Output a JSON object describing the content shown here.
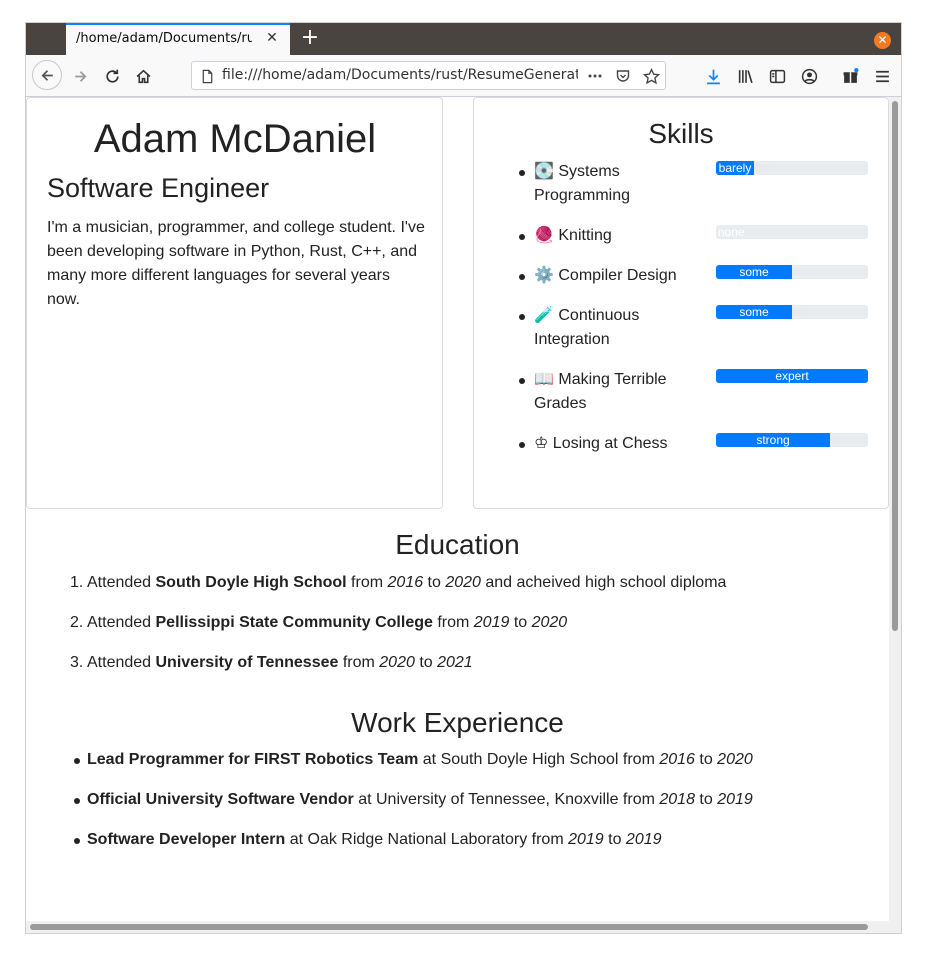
{
  "browser": {
    "tab_title": "/home/adam/Documents/rust",
    "tab_close": "✕",
    "new_tab": "+",
    "url": "file:///home/adam/Documents/rust/ResumeGenerator/",
    "window_close": "✕",
    "accent_color": "#0a84ff"
  },
  "profile": {
    "name": "Adam McDaniel",
    "role": "Software Engineer",
    "bio": "I'm a musician, programmer, and college student. I've been developing software in Python, Rust, C++, and many more different languages for several years now."
  },
  "skills": {
    "title": "Skills",
    "bar_color": "#007bff",
    "items": [
      {
        "icon": "💽",
        "label": "Systems Programming",
        "level": "barely",
        "fraction": 0.25
      },
      {
        "icon": "🧶",
        "label": "Knitting",
        "level": "none",
        "fraction": 0.0
      },
      {
        "icon": "⚙️",
        "label": "Compiler Design",
        "level": "some",
        "fraction": 0.5
      },
      {
        "icon": "🧪",
        "label": "Continuous Integration",
        "level": "some",
        "fraction": 0.5
      },
      {
        "icon": "📖",
        "label": "Making Terrible Grades",
        "level": "expert",
        "fraction": 1.0
      },
      {
        "icon": "♔",
        "label": "Losing at Chess",
        "level": "strong",
        "fraction": 0.75
      }
    ]
  },
  "education": {
    "title": "Education",
    "items": [
      {
        "num": "1.",
        "prefix": "Attended ",
        "school": "South Doyle High School",
        "from_word": " from ",
        "start": "2016",
        "to_word": " to ",
        "end": "2020",
        "suffix": " and acheived high school diploma"
      },
      {
        "num": "2.",
        "prefix": "Attended ",
        "school": "Pellissippi State Community College",
        "from_word": " from ",
        "start": "2019",
        "to_word": " to ",
        "end": "2020",
        "suffix": ""
      },
      {
        "num": "3.",
        "prefix": "Attended ",
        "school": "University of Tennessee",
        "from_word": " from ",
        "start": "2020",
        "to_word": " to ",
        "end": "2021",
        "suffix": ""
      }
    ]
  },
  "work": {
    "title": "Work Experience",
    "items": [
      {
        "position": "Lead Programmer for FIRST Robotics Team",
        "at": " at South Doyle High School from ",
        "start": "2016",
        "to_word": " to ",
        "end": "2020"
      },
      {
        "position": "Official University Software Vendor",
        "at": " at University of Tennessee, Knoxville from ",
        "start": "2018",
        "to_word": " to ",
        "end": "2019"
      },
      {
        "position": "Software Developer Intern",
        "at": " at Oak Ridge National Laboratory from ",
        "start": "2019",
        "to_word": " to ",
        "end": "2019"
      }
    ]
  }
}
